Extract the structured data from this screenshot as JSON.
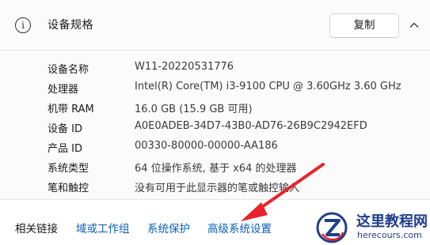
{
  "header": {
    "icon": "info-icon",
    "title": "设备规格",
    "copy_label": "复制",
    "collapse_icon": "chevron-up-icon"
  },
  "specs": [
    {
      "label": "设备名称",
      "value": "W11-20220531776"
    },
    {
      "label": "处理器",
      "value": "Intel(R) Core(TM) i3-9100 CPU @ 3.60GHz   3.60 GHz"
    },
    {
      "label": "机带 RAM",
      "value": "16.0 GB (15.9 GB 可用)"
    },
    {
      "label": "设备 ID",
      "value": "A0E0ADEB-34D7-43B0-AD76-26B9C2942EFD"
    },
    {
      "label": "产品 ID",
      "value": "00330-80000-00000-AA186"
    },
    {
      "label": "系统类型",
      "value": "64 位操作系统, 基于 x64 的处理器"
    },
    {
      "label": "笔和触控",
      "value": "没有可用于此显示器的笔或触控输入"
    }
  ],
  "footer": {
    "related_label": "相关链接",
    "links": [
      "域或工作组",
      "系统保护",
      "高级系统设置"
    ]
  },
  "colors": {
    "link": "#0a5fb5",
    "arrow": "#e8232a",
    "watermark": "#1f3e8a"
  },
  "watermark": {
    "title": "这里教程网",
    "url": "herecours.com"
  }
}
